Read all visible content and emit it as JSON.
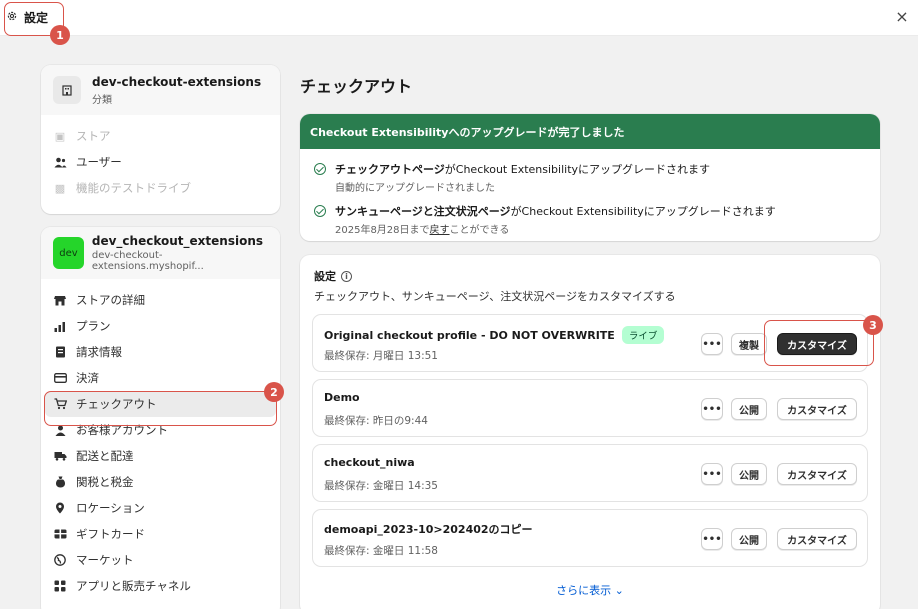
{
  "topbar": {
    "settings_label": "設定",
    "close_glyph": "×"
  },
  "annotations": [
    "1",
    "2",
    "3"
  ],
  "store_card": {
    "name": "dev-checkout-extensions",
    "sub": "分類",
    "items": [
      {
        "label": "ストア",
        "disabled": true
      },
      {
        "label": "ユーザー",
        "disabled": false
      },
      {
        "label": "機能のテストドライブ",
        "disabled": true
      }
    ]
  },
  "dev_card": {
    "avatar": "dev",
    "name": "dev_checkout_extensions",
    "domain": "dev-checkout-extensions.myshopif...",
    "items": [
      {
        "label": "ストアの詳細",
        "icon": "store-icon"
      },
      {
        "label": "プラン",
        "icon": "plan-icon"
      },
      {
        "label": "請求情報",
        "icon": "billing-icon"
      },
      {
        "label": "決済",
        "icon": "payments-icon"
      },
      {
        "label": "チェックアウト",
        "icon": "cart-icon"
      },
      {
        "label": "お客様アカウント",
        "icon": "person-icon"
      },
      {
        "label": "配送と配達",
        "icon": "truck-icon"
      },
      {
        "label": "関税と税金",
        "icon": "tax-icon"
      },
      {
        "label": "ロケーション",
        "icon": "location-icon"
      },
      {
        "label": "ギフトカード",
        "icon": "gift-card-icon"
      },
      {
        "label": "マーケット",
        "icon": "globe-icon"
      },
      {
        "label": "アプリと販売チャネル",
        "icon": "apps-icon"
      }
    ]
  },
  "main": {
    "title": "チェックアウト",
    "banner": {
      "title": "Checkout Extensibilityへのアップグレードが完了しました",
      "rows": [
        {
          "strong": "チェックアウトページ",
          "rest": "がCheckout Extensibilityにアップグレードされます",
          "sub_pre": "自動的にアップグレードされました",
          "sub_link": "",
          "sub_post": ""
        },
        {
          "strong": "サンキューページと注文状況ページ",
          "rest": "がCheckout Extensibilityにアップグレードされます",
          "sub_pre": "2025年8月28日まで",
          "sub_link": "戻す",
          "sub_post": "ことができる"
        }
      ]
    },
    "config": {
      "title": "設定",
      "description": "チェックアウト、サンキューページ、注文状況ページをカスタマイズする",
      "profiles": [
        {
          "name": "Original checkout profile - DO NOT OVERWRITE",
          "badge": "ライブ",
          "saved": "最終保存: 月曜日 13:51",
          "secondary": "複製",
          "customize": "カスタマイズ",
          "more": "•••"
        },
        {
          "name": "Demo",
          "badge": "",
          "saved": "最終保存: 昨日の9:44",
          "secondary": "公開",
          "customize": "カスタマイズ",
          "more": "•••"
        },
        {
          "name": "checkout_niwa",
          "badge": "",
          "saved": "最終保存: 金曜日 14:35",
          "secondary": "公開",
          "customize": "カスタマイズ",
          "more": "•••"
        },
        {
          "name": "demoapi_2023-10>202402のコピー",
          "badge": "",
          "saved": "最終保存: 金曜日 11:58",
          "secondary": "公開",
          "customize": "カスタマイズ",
          "more": "•••"
        }
      ],
      "show_more": "さらに表示 ⌄"
    }
  }
}
